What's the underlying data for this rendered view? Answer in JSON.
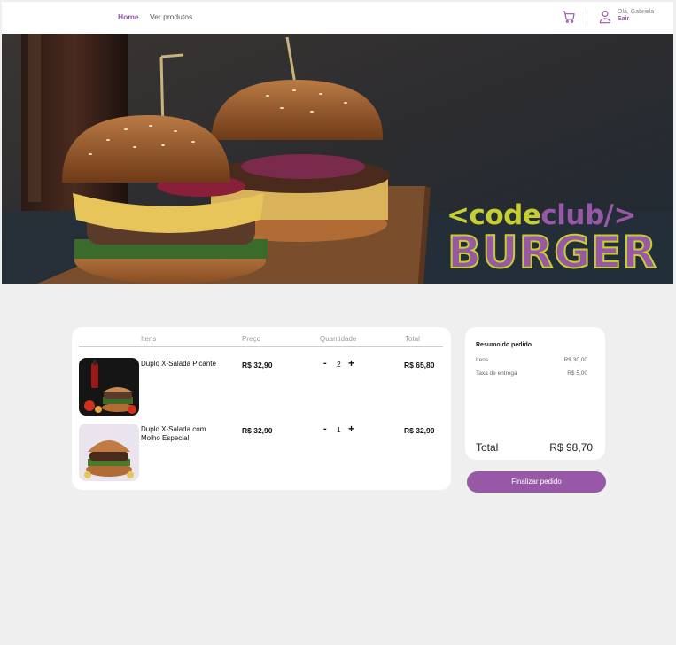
{
  "header": {
    "nav": {
      "home": "Home",
      "products": "Ver produtos"
    },
    "user": {
      "greeting": "Olá, Gabriela",
      "logout": "Sair"
    },
    "icons": {
      "cart": "cart-icon",
      "user": "user-icon"
    }
  },
  "banner": {
    "brand_line1_open": "<code",
    "brand_line1_club": "club/>",
    "brand_line2": "BURGER"
  },
  "cart": {
    "columns": {
      "items": "Itens",
      "price": "Preço",
      "quantity": "Quantidade",
      "total": "Total"
    },
    "rows": [
      {
        "name": "Duplo X-Salada Picante",
        "price": "R$ 32,90",
        "minus": "-",
        "qty": "2",
        "plus": "+",
        "total": "R$ 65,80"
      },
      {
        "name": "Duplo X-Salada com Molho Especial",
        "price": "R$ 32,90",
        "minus": "-",
        "qty": "1",
        "plus": "+",
        "total": "R$ 32,90"
      }
    ]
  },
  "summary": {
    "title": "Resumo do pedido",
    "items_label": "Itens",
    "items_value": "R$ 30,00",
    "delivery_label": "Taxa de entrega",
    "delivery_value": "R$ 5,00",
    "total_label": "Total",
    "total_value": "R$ 98,70"
  },
  "actions": {
    "finish": "Finalizar pedido"
  },
  "colors": {
    "accent": "#9758a6",
    "brand_green": "#c6cf2f",
    "background": "#efefef"
  }
}
